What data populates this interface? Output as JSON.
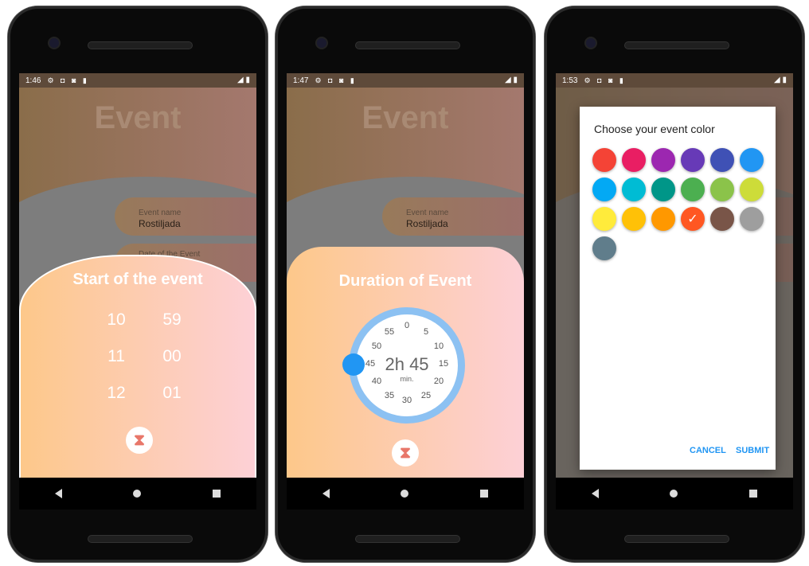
{
  "phones": [
    {
      "time": "1:46",
      "event_title": "Event",
      "event_name_label": "Event name",
      "event_name_value": "Rostiljada",
      "second_field_label": "Date of the Event",
      "sheet_title": "Start of the event",
      "hours": [
        "10",
        "11",
        "12"
      ],
      "minutes": [
        "59",
        "00",
        "01"
      ],
      "icon": "hourglass-icon"
    },
    {
      "time": "1:47",
      "event_title": "Event",
      "event_name_label": "Event name",
      "event_name_value": "Rostiljada",
      "sheet_title": "Duration of Event",
      "dial_numbers": [
        "0",
        "5",
        "10",
        "15",
        "20",
        "25",
        "30",
        "35",
        "40",
        "45",
        "50",
        "55"
      ],
      "duration_hours": "2h",
      "duration_minutes": "45",
      "duration_unit": "min.",
      "selected_minute": 45,
      "icon": "hourglass-icon"
    },
    {
      "time": "1:53",
      "dialog_title": "Choose your event color",
      "colors": [
        "#f44336",
        "#e91e63",
        "#9c27b0",
        "#673ab7",
        "#3f51b5",
        "#2196f3",
        "#03a9f4",
        "#00bcd4",
        "#009688",
        "#4caf50",
        "#8bc34a",
        "#cddc39",
        "#ffeb3b",
        "#ffc107",
        "#ff9800",
        "#ff5722",
        "#795548",
        "#9e9e9e",
        "#607d8b"
      ],
      "selected_color": "#ff5722",
      "selected_mark": "✓",
      "cancel_label": "CANCEL",
      "submit_label": "SUBMIT"
    }
  ],
  "status_icons": "⚙ ◘ ◙ ▮",
  "signal": "◢ ▮"
}
